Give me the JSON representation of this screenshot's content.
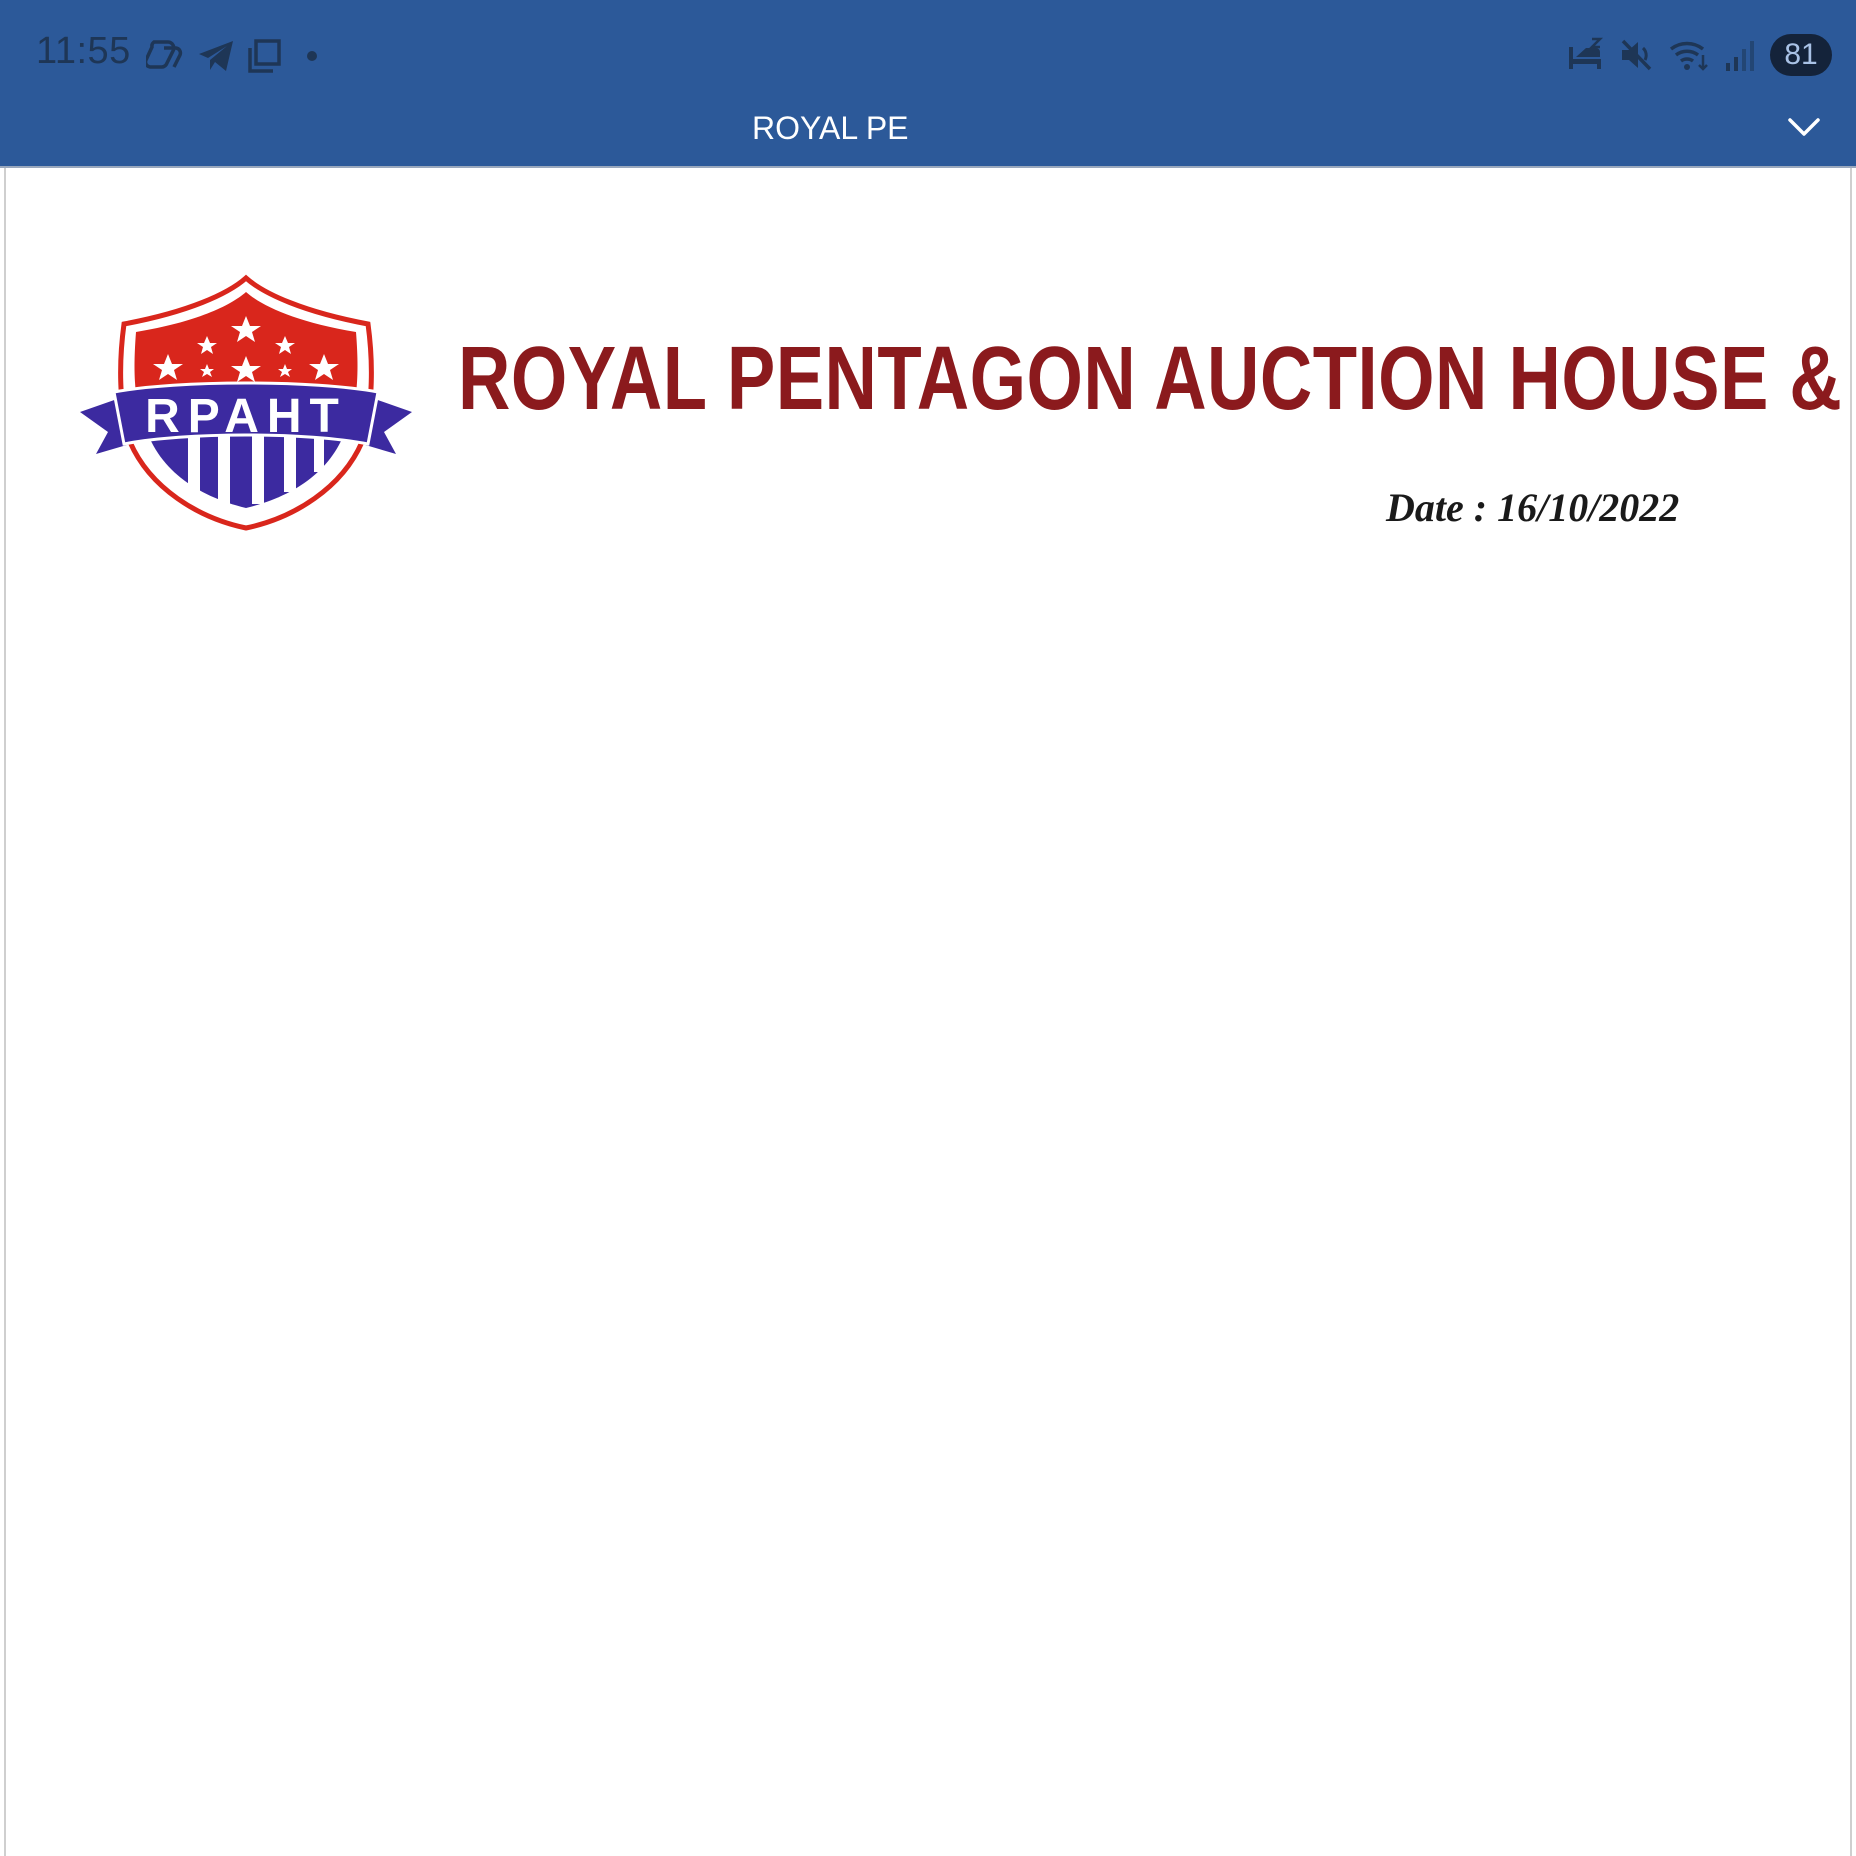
{
  "status_bar": {
    "time": "11:55",
    "battery_level": "81",
    "left_icons": [
      "copilot-icon",
      "telegram-icon",
      "window-icon",
      "dot-icon"
    ],
    "right_icons": [
      "sleep-mode-icon",
      "mute-icon",
      "wifi-icon",
      "signal-icon",
      "battery-icon"
    ]
  },
  "toolbar": {
    "document_title": "ROYAL PENTAGON AUCTION HOUSE & TRADE",
    "expand_icon": "chevron-down-icon"
  },
  "document": {
    "company_name": "ROYAL PENTAGON AUCTION HOUSE & TRADE",
    "date_line": "Date : 16/10/2022",
    "logo": {
      "monogram": "RPAHT"
    }
  },
  "colors": {
    "toolbar_bg": "#2c5999",
    "company_red": "#8b1a1d",
    "logo_red": "#d9261c",
    "logo_blue": "#3c2aa0"
  }
}
